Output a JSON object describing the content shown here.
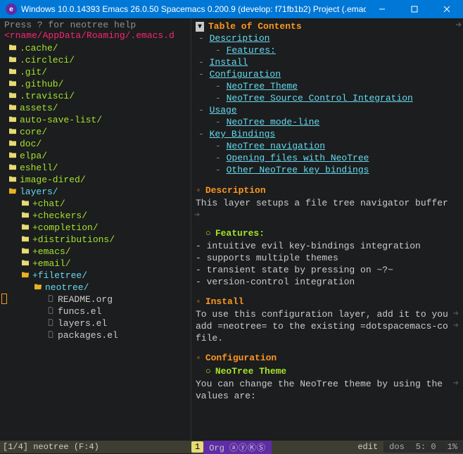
{
  "titlebar": {
    "title": "Windows 10.0.14393  Emacs 26.0.50  Spacemacs 0.200.9 (develop: f71fb1b2)  Project (.emac..."
  },
  "sidebar": {
    "help": "Press ? for neotree help",
    "root": "<rname/AppData/Roaming/.emacs.d",
    "items": [
      {
        "type": "dir",
        "depth": 0,
        "open": false,
        "label": ".cache/"
      },
      {
        "type": "dir",
        "depth": 0,
        "open": false,
        "label": ".circleci/"
      },
      {
        "type": "dir",
        "depth": 0,
        "open": false,
        "label": ".git/"
      },
      {
        "type": "dir",
        "depth": 0,
        "open": false,
        "label": ".github/"
      },
      {
        "type": "dir",
        "depth": 0,
        "open": false,
        "label": ".travisci/"
      },
      {
        "type": "dir",
        "depth": 0,
        "open": false,
        "label": "assets/"
      },
      {
        "type": "dir",
        "depth": 0,
        "open": false,
        "label": "auto-save-list/"
      },
      {
        "type": "dir",
        "depth": 0,
        "open": false,
        "label": "core/"
      },
      {
        "type": "dir",
        "depth": 0,
        "open": false,
        "label": "doc/"
      },
      {
        "type": "dir",
        "depth": 0,
        "open": false,
        "label": "elpa/"
      },
      {
        "type": "dir",
        "depth": 0,
        "open": false,
        "label": "eshell/"
      },
      {
        "type": "dir",
        "depth": 0,
        "open": false,
        "label": "image-dired/"
      },
      {
        "type": "dir",
        "depth": 0,
        "open": true,
        "label": "layers/"
      },
      {
        "type": "dir",
        "depth": 1,
        "open": false,
        "label": "+chat/"
      },
      {
        "type": "dir",
        "depth": 1,
        "open": false,
        "label": "+checkers/"
      },
      {
        "type": "dir",
        "depth": 1,
        "open": false,
        "label": "+completion/"
      },
      {
        "type": "dir",
        "depth": 1,
        "open": false,
        "label": "+distributions/"
      },
      {
        "type": "dir",
        "depth": 1,
        "open": false,
        "label": "+emacs/"
      },
      {
        "type": "dir",
        "depth": 1,
        "open": false,
        "label": "+email/"
      },
      {
        "type": "dir",
        "depth": 1,
        "open": true,
        "label": "+filetree/"
      },
      {
        "type": "dir",
        "depth": 2,
        "open": true,
        "label": "neotree/"
      },
      {
        "type": "file",
        "depth": 3,
        "label": "README.org"
      },
      {
        "type": "file",
        "depth": 3,
        "label": "funcs.el"
      },
      {
        "type": "file",
        "depth": 3,
        "label": "layers.el"
      },
      {
        "type": "file",
        "depth": 3,
        "label": "packages.el"
      }
    ]
  },
  "content": {
    "toc_title": "Table of Contents",
    "toc": [
      {
        "depth": 0,
        "text": "Description"
      },
      {
        "depth": 1,
        "text": "Features:"
      },
      {
        "depth": 0,
        "text": "Install"
      },
      {
        "depth": 0,
        "text": "Configuration"
      },
      {
        "depth": 1,
        "text": "NeoTree Theme"
      },
      {
        "depth": 1,
        "text": "NeoTree Source Control Integration"
      },
      {
        "depth": 0,
        "text": "Usage"
      },
      {
        "depth": 1,
        "text": "NeoTree mode-line"
      },
      {
        "depth": 0,
        "text": "Key Bindings"
      },
      {
        "depth": 1,
        "text": "NeoTree navigation"
      },
      {
        "depth": 1,
        "text": "Opening files with NeoTree"
      },
      {
        "depth": 1,
        "text": "Other NeoTree key bindings"
      }
    ],
    "sections": {
      "description": {
        "h": "Description",
        "body": "This layer setups a file tree navigator buffer"
      },
      "features": {
        "h": "Features:",
        "lines": [
          "- intuitive evil key-bindings integration",
          "- supports multiple themes",
          "- transient state by pressing on ~?~",
          "- version-control integration"
        ]
      },
      "install": {
        "h": "Install",
        "lines": [
          "To use this configuration layer, add it to you",
          "add =neotree= to the existing =dotspacemacs-co",
          "file."
        ]
      },
      "configuration": {
        "h": "Configuration"
      },
      "theme": {
        "h": "NeoTree Theme",
        "lines": [
          "You can change the NeoTree theme by using the ",
          "values are:"
        ]
      }
    }
  },
  "modeline": {
    "left": "[1/4] neotree (F:4)",
    "badge": "1",
    "mode": "Org",
    "circled": "ⓐⓨⓀⓈ",
    "edit": "edit",
    "enc": "dos",
    "pos": "5: 0",
    "pct": "1%"
  }
}
